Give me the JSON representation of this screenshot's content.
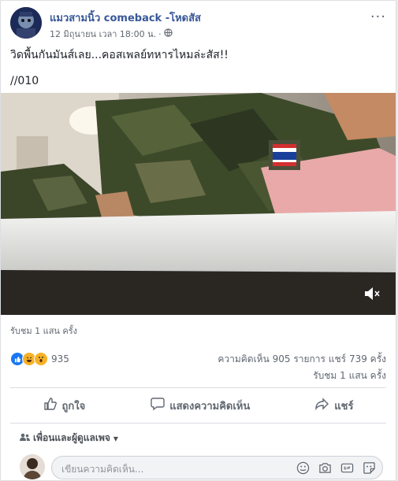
{
  "post": {
    "author": "แมวสามนิ้ว comeback -โหดสัส",
    "date": "12 มิถุนายน เวลา 18:00 น.",
    "separator": "·",
    "more_label": "···",
    "text_line1": "วิดพื้นกันมันส์เลย...คอสเพลย์ทหารไหมล่ะสัส!!",
    "text_line2": "//010"
  },
  "video": {
    "volume_icon": "speaker-muted-icon",
    "mute_mark": "×"
  },
  "views_top": "รับชม 1 แสน ครั้ง",
  "reactions": {
    "count": "935",
    "icons": [
      "like-icon",
      "haha-icon",
      "wow-icon"
    ],
    "colors": {
      "like": "#1877f2",
      "haha": "#f7b125",
      "wow": "#f7b125"
    }
  },
  "stats": {
    "comments_shares": "ความคิดเห็น 905 รายการ  แชร์ 739 ครั้ง",
    "views": "รับชม 1 แสน ครั้ง"
  },
  "actions": {
    "like": "ถูกใจ",
    "comment": "แสดงความคิดเห็น",
    "share": "แชร์"
  },
  "audience": {
    "label": "เพื่อนและผู้ดูแลเพจ",
    "caret": "▾"
  },
  "composer": {
    "placeholder": "เขียนความคิดเห็น..."
  },
  "colors": {
    "link": "#385898",
    "secondary": "#606770"
  }
}
